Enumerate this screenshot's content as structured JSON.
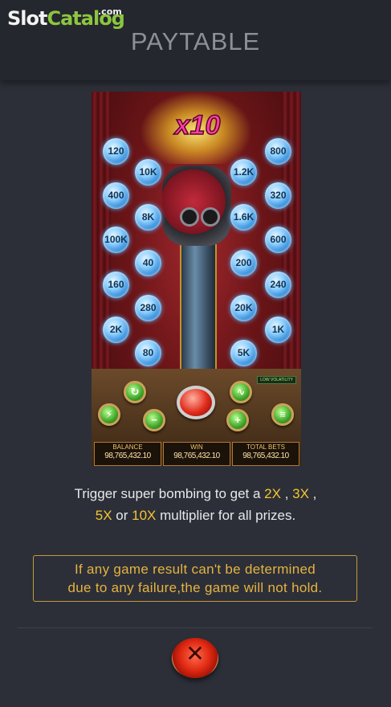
{
  "watermark": {
    "part1": "Slot",
    "part2": "Catalog",
    "suffix": ".com"
  },
  "title": "PAYTABLE",
  "game": {
    "multiplier": "x10",
    "left_outer": [
      "120",
      "400",
      "100K",
      "160",
      "2K"
    ],
    "left_inner": [
      "10K",
      "8K",
      "40",
      "280",
      "80"
    ],
    "right_inner": [
      "1.2K",
      "1.6K",
      "200",
      "20K",
      "5K"
    ],
    "right_outer": [
      "800",
      "320",
      "600",
      "240",
      "1K"
    ],
    "volatility": "LOW VOLATILITY",
    "balance_label": "BALANCE",
    "balance_value": "98,765,432.10",
    "win_label": "WIN",
    "win_value": "98,765,432.10",
    "bets_label": "TOTAL BETS",
    "bets_value": "98,765,432.10"
  },
  "description": {
    "part1": "Trigger super bombing to get a ",
    "m2": "2X",
    "sep1": " , ",
    "m3": "3X",
    "sep2": " ,",
    "m5": "5X",
    "or": " or ",
    "m10": "10X",
    "part2": " multiplier for all prizes."
  },
  "note": {
    "line1": "If any game result can't be determined",
    "line2": "due to any failure,the game will not hold."
  },
  "colors": {
    "accent": "#f5c431",
    "background": "#2c2f38",
    "header": "#25272e"
  }
}
